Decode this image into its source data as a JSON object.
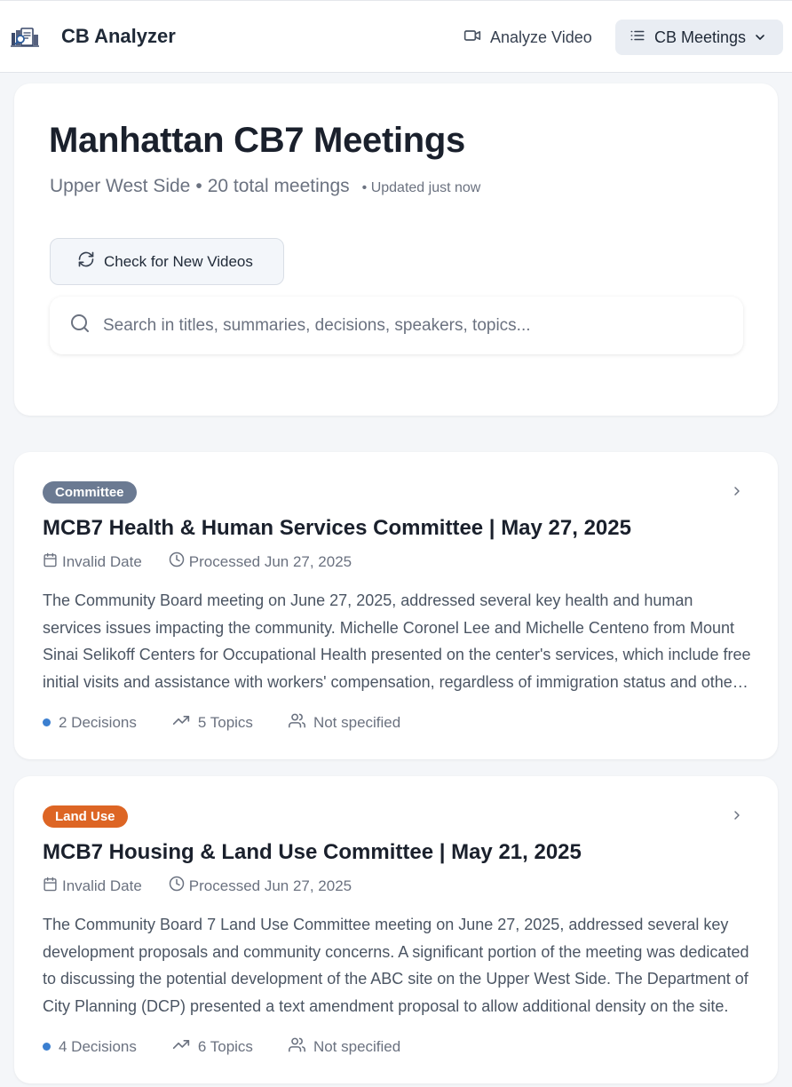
{
  "header": {
    "app_title": "CB Analyzer",
    "analyze_label": "Analyze Video",
    "meetings_label": "CB Meetings"
  },
  "page": {
    "title": "Manhattan CB7 Meetings",
    "area": "Upper West Side",
    "separator": "•",
    "total": "20 total meetings",
    "updated": "• Updated just now",
    "check_label": "Check for New Videos",
    "search_placeholder": "Search in titles, summaries, decisions, speakers, topics..."
  },
  "meetings": [
    {
      "badge": "Committee",
      "badge_color": "#6b7a92",
      "title": "MCB7 Health & Human Services Committee | May 27, 2025",
      "date": "Invalid Date",
      "processed": "Processed Jun 27, 2025",
      "summary": "The Community Board meeting on June 27, 2025, addressed several key health and human services issues impacting the community. Michelle Coronel Lee and Michelle Centeno from Mount Sinai Selikoff Centers for Occupational Health presented on the center's services, which include free initial visits and assistance with workers' compensation, regardless of immigration status and other eligibility requirements.",
      "decisions": "2 Decisions",
      "topics": "5 Topics",
      "speakers": "Not specified"
    },
    {
      "badge": "Land Use",
      "badge_color": "#dd6524",
      "title": "MCB7 Housing & Land Use Committee | May 21, 2025",
      "date": "Invalid Date",
      "processed": "Processed Jun 27, 2025",
      "summary": "The Community Board 7 Land Use Committee meeting on June 27, 2025, addressed several key development proposals and community concerns. A significant portion of the meeting was dedicated to discussing the potential development of the ABC site on the Upper West Side. The Department of City Planning (DCP) presented a text amendment proposal to allow additional density on the site.",
      "decisions": "4 Decisions",
      "topics": "6 Topics",
      "speakers": "Not specified"
    }
  ],
  "colors": {
    "decision_dot": "#3b7fd0",
    "accent_bg": "#e9edf3"
  },
  "icons": [
    "logo-icon",
    "video-icon",
    "list-icon",
    "chevron-down-icon",
    "refresh-icon",
    "search-icon",
    "chevron-right-icon",
    "calendar-icon",
    "clock-icon",
    "trending-icon",
    "users-icon"
  ]
}
